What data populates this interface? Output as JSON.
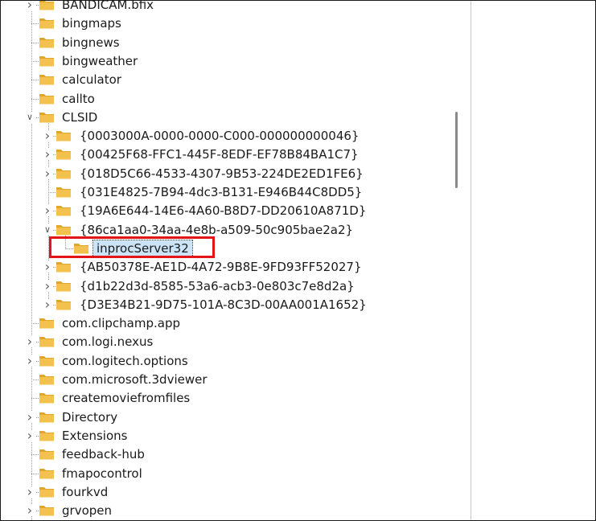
{
  "tree": {
    "items": [
      {
        "label": "BANDICAM.bfix",
        "depth": 0,
        "expander": "collapsed"
      },
      {
        "label": "bingmaps",
        "depth": 0,
        "expander": "none"
      },
      {
        "label": "bingnews",
        "depth": 0,
        "expander": "none"
      },
      {
        "label": "bingweather",
        "depth": 0,
        "expander": "none"
      },
      {
        "label": "calculator",
        "depth": 0,
        "expander": "none"
      },
      {
        "label": "callto",
        "depth": 0,
        "expander": "none"
      },
      {
        "label": "CLSID",
        "depth": 0,
        "expander": "expanded"
      },
      {
        "label": "{0003000A-0000-0000-C000-000000000046}",
        "depth": 1,
        "expander": "collapsed"
      },
      {
        "label": "{00425F68-FFC1-445F-8EDF-EF78B84BA1C7}",
        "depth": 1,
        "expander": "collapsed"
      },
      {
        "label": "{018D5C66-4533-4307-9B53-224DE2ED1FE6}",
        "depth": 1,
        "expander": "collapsed"
      },
      {
        "label": "{031E4825-7B94-4dc3-B131-E946B44C8DD5}",
        "depth": 1,
        "expander": "none"
      },
      {
        "label": "{19A6E644-14E6-4A60-B8D7-DD20610A871D}",
        "depth": 1,
        "expander": "collapsed"
      },
      {
        "label": "{86ca1aa0-34aa-4e8b-a509-50c905bae2a2}",
        "depth": 1,
        "expander": "expanded"
      },
      {
        "label": "inprocServer32",
        "depth": 2,
        "expander": "none",
        "selected": true
      },
      {
        "label": "{AB50378E-AE1D-4A72-9B8E-9FD93FF52027}",
        "depth": 1,
        "expander": "collapsed"
      },
      {
        "label": "{d1b22d3d-8585-53a6-acb3-0e803c7e8d2a}",
        "depth": 1,
        "expander": "collapsed"
      },
      {
        "label": "{D3E34B21-9D75-101A-8C3D-00AA001A1652}",
        "depth": 1,
        "expander": "collapsed"
      },
      {
        "label": "com.clipchamp.app",
        "depth": 0,
        "expander": "none"
      },
      {
        "label": "com.logi.nexus",
        "depth": 0,
        "expander": "collapsed"
      },
      {
        "label": "com.logitech.options",
        "depth": 0,
        "expander": "collapsed"
      },
      {
        "label": "com.microsoft.3dviewer",
        "depth": 0,
        "expander": "none"
      },
      {
        "label": "createmoviefromfiles",
        "depth": 0,
        "expander": "none"
      },
      {
        "label": "Directory",
        "depth": 0,
        "expander": "collapsed"
      },
      {
        "label": "Extensions",
        "depth": 0,
        "expander": "collapsed"
      },
      {
        "label": "feedback-hub",
        "depth": 0,
        "expander": "none"
      },
      {
        "label": "fmapocontrol",
        "depth": 0,
        "expander": "none"
      },
      {
        "label": "fourkvd",
        "depth": 0,
        "expander": "collapsed"
      },
      {
        "label": "grvopen",
        "depth": 0,
        "expander": "collapsed"
      }
    ]
  },
  "colors": {
    "folder_body": "#f2c14e",
    "folder_tab": "#e0a62c",
    "highlight_box": "#e4141b",
    "selection": "#cce4f7"
  },
  "icons": {
    "folder": "folder-icon",
    "expand": "chevron-right-icon",
    "collapse": "chevron-down-icon"
  }
}
